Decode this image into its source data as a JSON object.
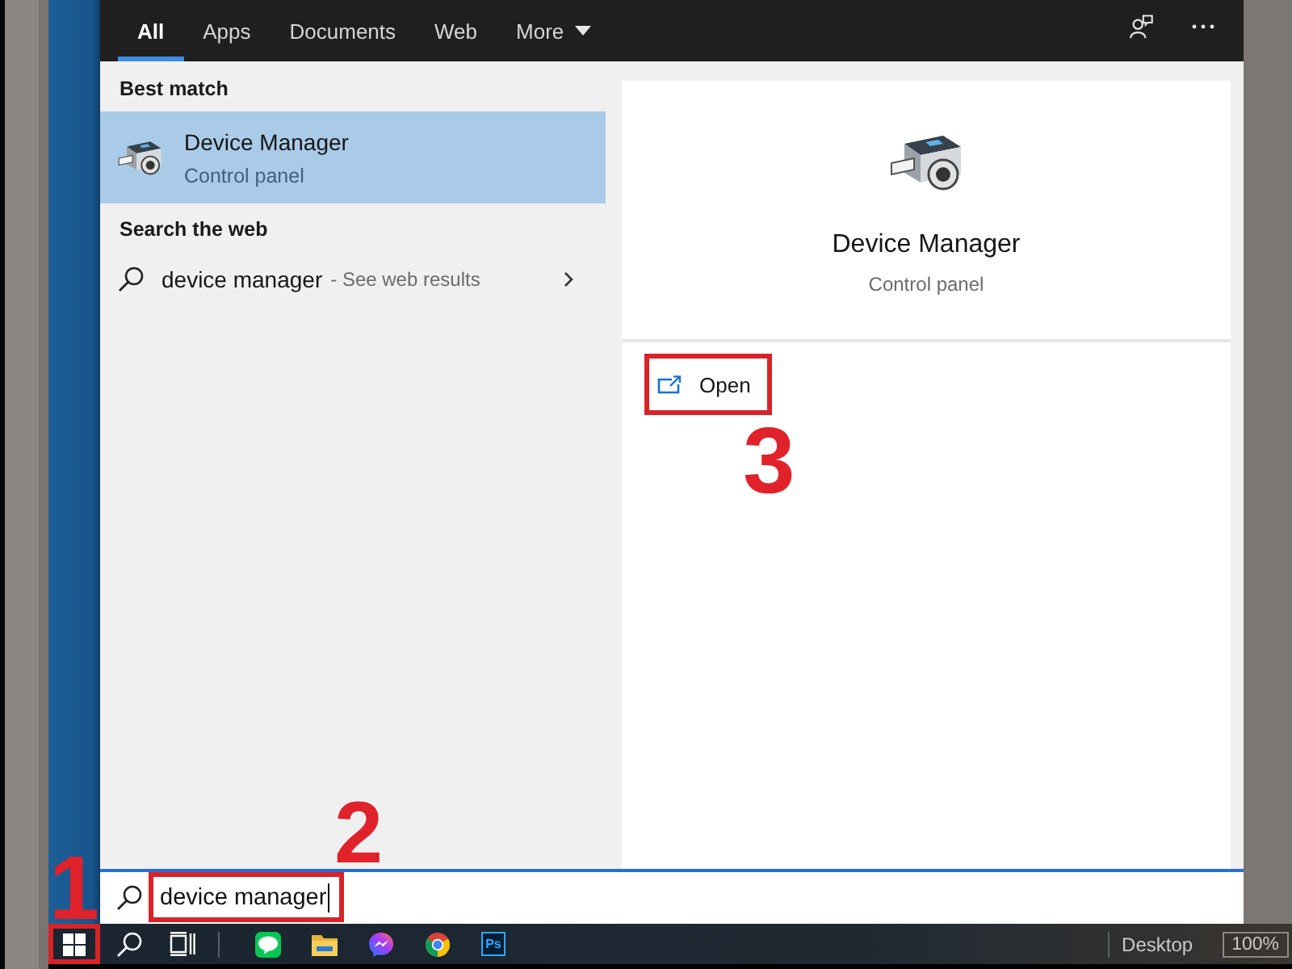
{
  "tabs": [
    {
      "label": "All",
      "selected": true,
      "kind": "plain"
    },
    {
      "label": "Apps",
      "selected": false,
      "kind": "plain"
    },
    {
      "label": "Documents",
      "selected": false,
      "kind": "plain"
    },
    {
      "label": "Web",
      "selected": false,
      "kind": "plain"
    },
    {
      "label": "More",
      "selected": false,
      "kind": "dropdown"
    }
  ],
  "results": [
    {
      "heading": "Best match",
      "items": [
        {
          "kind": "app",
          "title": "Device Manager",
          "subtitle": "Control panel",
          "selected": true
        }
      ]
    },
    {
      "heading": "Search the web",
      "items": [
        {
          "kind": "web",
          "title": "device manager",
          "subtitle": "- See web results",
          "selected": false
        }
      ]
    }
  ],
  "preview": {
    "title": "Device Manager",
    "subtitle": "Control panel",
    "actions": [
      {
        "label": "Open",
        "highlighted": true,
        "step": "3"
      }
    ]
  },
  "search_box": {
    "value": "device manager",
    "highlighted": true,
    "step": "2"
  },
  "taskbar": {
    "start_button": {
      "highlighted": true,
      "step": "1"
    },
    "pinned": [
      {
        "kind": "chat"
      },
      {
        "kind": "folder"
      },
      {
        "kind": "messenger"
      },
      {
        "kind": "browser"
      },
      {
        "kind": "editor",
        "label": "Ps"
      }
    ],
    "tray": {
      "label": "Desktop",
      "zoom": "100%"
    }
  }
}
